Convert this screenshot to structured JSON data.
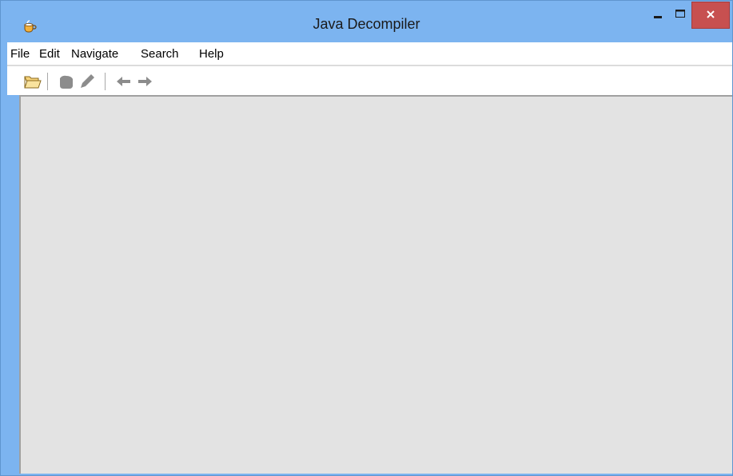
{
  "window": {
    "title": "Java Decompiler",
    "accent_color": "#7cb4f0",
    "close_color": "#c75050"
  },
  "menubar": {
    "items": [
      {
        "label": "File"
      },
      {
        "label": "Edit"
      },
      {
        "label": "Navigate"
      },
      {
        "label": "Search"
      },
      {
        "label": "Help"
      }
    ]
  },
  "toolbar": {
    "buttons": [
      {
        "icon": "open-folder-icon",
        "enabled": true
      },
      {
        "icon": "close-file-icon",
        "enabled": false
      },
      {
        "icon": "edit-pencil-icon",
        "enabled": false
      },
      {
        "icon": "back-arrow-icon",
        "enabled": false
      },
      {
        "icon": "forward-arrow-icon",
        "enabled": false
      }
    ]
  }
}
